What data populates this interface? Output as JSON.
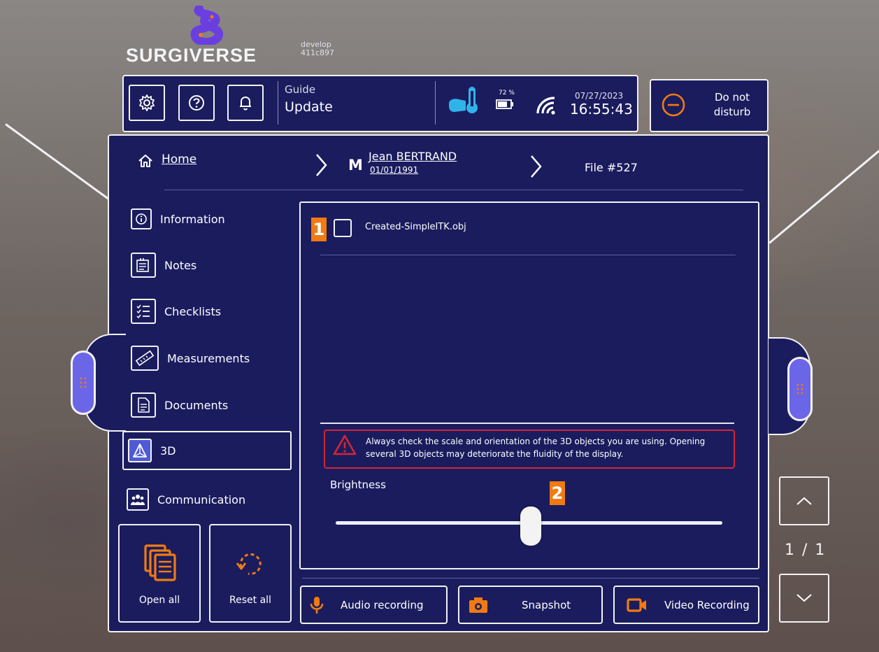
{
  "brand": {
    "name": "SURGIVERSE",
    "branch": "develop",
    "commit": "411c897"
  },
  "topbar": {
    "settings_icon": "gear-icon",
    "help_icon": "question-icon",
    "notifications_icon": "bell-icon",
    "guide_label": "Guide",
    "guide_value": "Update",
    "battery_percent": "72 %",
    "date": "07/27/2023",
    "time": "16:55:43",
    "do_not_disturb": "Do not disturb"
  },
  "breadcrumb": {
    "home": "Home",
    "patient_gender": "M",
    "patient_name": "Jean BERTRAND",
    "patient_dob": "01/01/1991",
    "file": "File #527"
  },
  "sidebar": {
    "items": [
      {
        "label": "Information",
        "icon": "info-icon"
      },
      {
        "label": "Notes",
        "icon": "notes-icon"
      },
      {
        "label": "Checklists",
        "icon": "checklist-icon"
      },
      {
        "label": "Measurements",
        "icon": "ruler-icon"
      },
      {
        "label": "Documents",
        "icon": "document-icon"
      },
      {
        "label": "3D",
        "icon": "3d-icon",
        "active": true
      },
      {
        "label": "Communication",
        "icon": "people-icon"
      }
    ],
    "open_all": "Open all",
    "reset_all": "Reset all"
  },
  "files": {
    "items": [
      {
        "name": "Created-SimpleITK.obj",
        "checked": false
      }
    ],
    "badge_1": "1",
    "badge_2": "2"
  },
  "warning": "Always check the scale and orientation of the 3D objects you are using. Opening several 3D objects may deteriorate the fluidity of the display.",
  "brightness": {
    "label": "Brightness",
    "value": 0.5
  },
  "recording": {
    "audio": "Audio recording",
    "snapshot": "Snapshot",
    "video": "Video Recording"
  },
  "pager": {
    "page": "1 / 1"
  },
  "colors": {
    "panel": "#1b1c5e",
    "accent": "#f07b12",
    "warning": "#d52434",
    "handle": "#6b65e8"
  }
}
